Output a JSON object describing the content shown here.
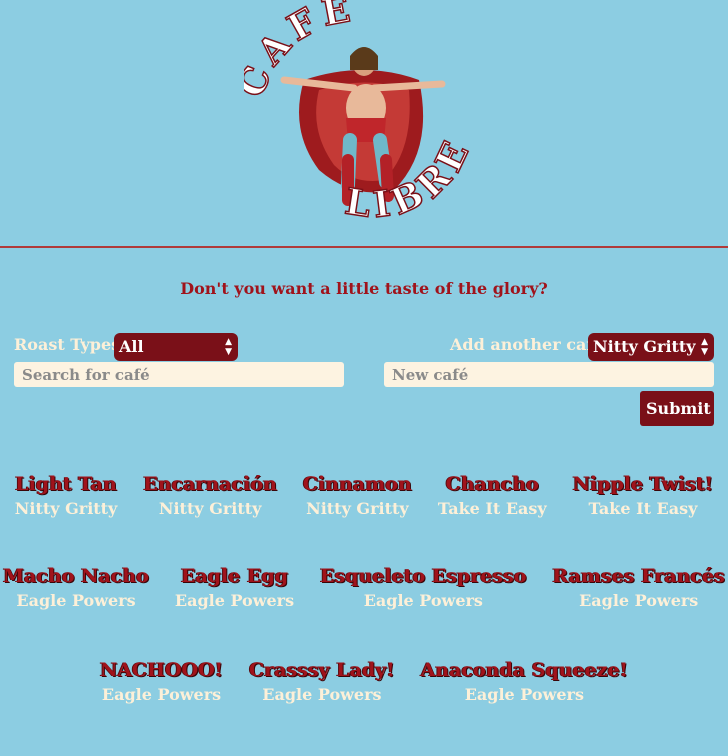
{
  "logo": {
    "top_text": "CAFÉ",
    "bottom_text": "LIBRE"
  },
  "tagline": "Don't you want a little taste of the glory?",
  "filter": {
    "label": "Roast Types",
    "selected": "All",
    "search_placeholder": "Search for café"
  },
  "add": {
    "label": "Add another café",
    "selected": "Nitty Gritty",
    "name_placeholder": "New café",
    "submit_label": "Submit"
  },
  "colors": {
    "background": "#8ccde2",
    "accent": "#a0131b",
    "button": "#7a1018",
    "light_text": "#fdf0d8"
  },
  "cafes": [
    {
      "name": "Light Tan",
      "roast": "Nitty Gritty"
    },
    {
      "name": "Encarnación",
      "roast": "Nitty Gritty"
    },
    {
      "name": "Cinnamon",
      "roast": "Nitty Gritty"
    },
    {
      "name": "Chancho",
      "roast": "Take It Easy"
    },
    {
      "name": "Nipple Twist!",
      "roast": "Take It Easy"
    },
    {
      "name": "Macho Nacho",
      "roast": "Eagle Powers"
    },
    {
      "name": "Eagle Egg",
      "roast": "Eagle Powers"
    },
    {
      "name": "Esqueleto Espresso",
      "roast": "Eagle Powers"
    },
    {
      "name": "Ramses Francés",
      "roast": "Eagle Powers"
    },
    {
      "name": "NACHOOO!",
      "roast": "Eagle Powers"
    },
    {
      "name": "Crasssy Lady!",
      "roast": "Eagle Powers"
    },
    {
      "name": "Anaconda Squeeze!",
      "roast": "Eagle Powers"
    }
  ]
}
